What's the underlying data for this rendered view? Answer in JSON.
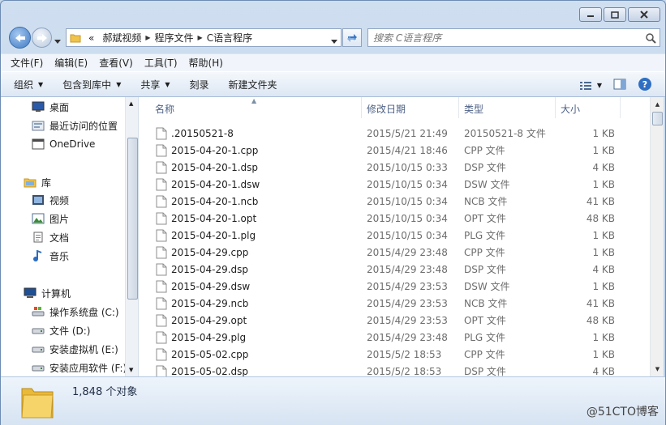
{
  "address": {
    "prefix": "«",
    "crumbs": [
      "郝斌视频",
      "程序文件",
      "C语言程序"
    ]
  },
  "search": {
    "placeholder": "搜索 C语言程序"
  },
  "menu": [
    "文件(F)",
    "编辑(E)",
    "查看(V)",
    "工具(T)",
    "帮助(H)"
  ],
  "commands": {
    "organize": "组织",
    "include_library": "包含到库中",
    "share": "共享",
    "burn": "刻录",
    "new_folder": "新建文件夹"
  },
  "nav": {
    "favorites": [
      {
        "label": "桌面",
        "icon": "desktop-icon"
      },
      {
        "label": "最近访问的位置",
        "icon": "recent-places-icon"
      },
      {
        "label": "OneDrive",
        "icon": "onedrive-icon"
      }
    ],
    "libraries_title": "库",
    "libraries": [
      {
        "label": "视频",
        "icon": "video-icon"
      },
      {
        "label": "图片",
        "icon": "pictures-icon"
      },
      {
        "label": "文档",
        "icon": "documents-icon"
      },
      {
        "label": "音乐",
        "icon": "music-icon"
      }
    ],
    "computer_title": "计算机",
    "drives": [
      {
        "label": "操作系统盘 (C:)",
        "icon": "system-drive-icon"
      },
      {
        "label": "文件 (D:)",
        "icon": "drive-icon"
      },
      {
        "label": "安装虚拟机 (E:)",
        "icon": "drive-icon"
      },
      {
        "label": "安装应用软件 (F:)",
        "icon": "drive-icon"
      }
    ]
  },
  "columns": {
    "name": "名称",
    "date": "修改日期",
    "type": "类型",
    "size": "大小"
  },
  "files": [
    {
      "name": ".20150521-8",
      "date": "2015/5/21 21:49",
      "type": "20150521-8 文件",
      "size": "1 KB"
    },
    {
      "name": "2015-04-20-1.cpp",
      "date": "2015/4/21 18:46",
      "type": "CPP 文件",
      "size": "1 KB"
    },
    {
      "name": "2015-04-20-1.dsp",
      "date": "2015/10/15 0:33",
      "type": "DSP 文件",
      "size": "4 KB"
    },
    {
      "name": "2015-04-20-1.dsw",
      "date": "2015/10/15 0:34",
      "type": "DSW 文件",
      "size": "1 KB"
    },
    {
      "name": "2015-04-20-1.ncb",
      "date": "2015/10/15 0:34",
      "type": "NCB 文件",
      "size": "41 KB"
    },
    {
      "name": "2015-04-20-1.opt",
      "date": "2015/10/15 0:34",
      "type": "OPT 文件",
      "size": "48 KB"
    },
    {
      "name": "2015-04-20-1.plg",
      "date": "2015/10/15 0:34",
      "type": "PLG 文件",
      "size": "1 KB"
    },
    {
      "name": "2015-04-29.cpp",
      "date": "2015/4/29 23:48",
      "type": "CPP 文件",
      "size": "1 KB"
    },
    {
      "name": "2015-04-29.dsp",
      "date": "2015/4/29 23:48",
      "type": "DSP 文件",
      "size": "4 KB"
    },
    {
      "name": "2015-04-29.dsw",
      "date": "2015/4/29 23:53",
      "type": "DSW 文件",
      "size": "1 KB"
    },
    {
      "name": "2015-04-29.ncb",
      "date": "2015/4/29 23:53",
      "type": "NCB 文件",
      "size": "41 KB"
    },
    {
      "name": "2015-04-29.opt",
      "date": "2015/4/29 23:53",
      "type": "OPT 文件",
      "size": "48 KB"
    },
    {
      "name": "2015-04-29.plg",
      "date": "2015/4/29 23:48",
      "type": "PLG 文件",
      "size": "1 KB"
    },
    {
      "name": "2015-05-02.cpp",
      "date": "2015/5/2 18:53",
      "type": "CPP 文件",
      "size": "1 KB"
    },
    {
      "name": "2015-05-02.dsp",
      "date": "2015/5/2 18:53",
      "type": "DSP 文件",
      "size": "4 KB"
    }
  ],
  "status": {
    "count": "1,848 个对象"
  },
  "watermark": "@51CTO博客"
}
